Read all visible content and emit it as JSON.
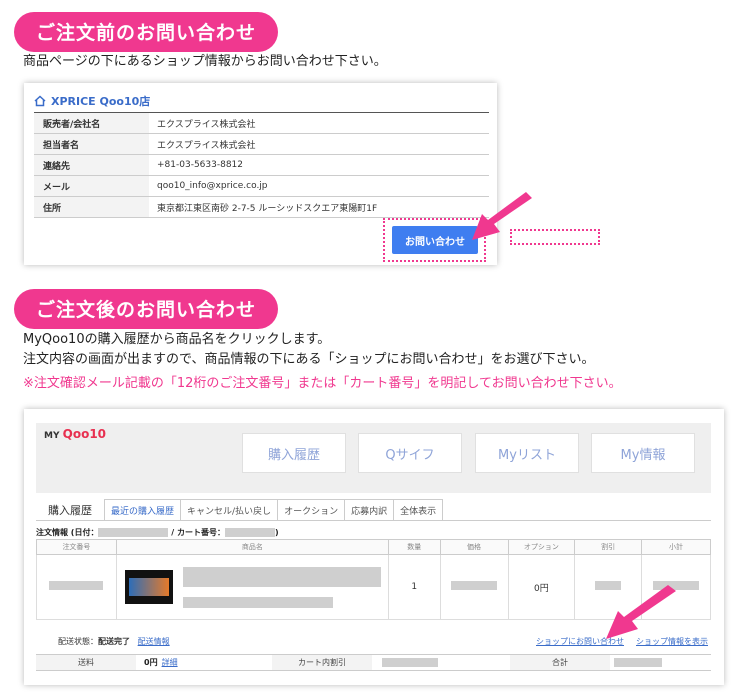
{
  "section1": {
    "heading": "ご注文前のお問い合わせ",
    "intro": "商品ページの下にあるショップ情報からお問い合わせ下さい。",
    "shop_name": "XPRICE Qoo10店",
    "info_rows": [
      {
        "label": "販売者/会社名",
        "value": "エクスプライス株式会社"
      },
      {
        "label": "担当者名",
        "value": "エクスプライス株式会社"
      },
      {
        "label": "連絡先",
        "value": "+81-03-5633-8812"
      },
      {
        "label": "メール",
        "value": "qoo10_info@xprice.co.jp"
      },
      {
        "label": "住所",
        "value": "東京都江東区南砂 2-7-5 ルーシッドスクエア東陽町1F"
      }
    ],
    "contact_button": "お問い合わせ"
  },
  "section2": {
    "heading": "ご注文後のお問い合わせ",
    "line1": "MyQoo10の購入履歴から商品名をクリックします。",
    "line2": "注文内容の画面が出ますので、商品情報の下にある「ショップにお問い合わせ」をお選び下さい。",
    "note": "※注文確認メール記載の「12桁のご注文番号」または「カート番号」を明記してお問い合わせ下さい。"
  },
  "myqoo10": {
    "logo_prefix": "MY",
    "logo_brand": "Qoo10",
    "nav": [
      "購入履歴",
      "Qサイフ",
      "Myリスト",
      "My情報"
    ],
    "section_label": "購入履歴",
    "tabs": [
      "最近の購入履歴",
      "キャンセル/払い戻し",
      "オークション",
      "応募内訳",
      "全体表示"
    ],
    "order_info_prefix": "注文情報 (日付：",
    "order_info_cart": "/ カート番号：",
    "order_info_suffix": ")",
    "columns": [
      "注文番号",
      "商品名",
      "数量",
      "価格",
      "オプション",
      "割引",
      "小計"
    ],
    "row": {
      "quantity": "1",
      "option": "0円"
    },
    "status_label": "配送状態：",
    "status_value": "配送完了",
    "delivery_info": "配送情報",
    "shop_contact": "ショップにお問い合わせ",
    "shop_info": "ショップ情報を表示",
    "shipping_label": "送料",
    "shipping_value": "0円",
    "shipping_detail": "詳細",
    "cart_discount": "カート内割引",
    "total": "合計"
  },
  "colors": {
    "pink": "#f0388f",
    "blue": "#3f7ef0",
    "link": "#3a6cc9"
  }
}
